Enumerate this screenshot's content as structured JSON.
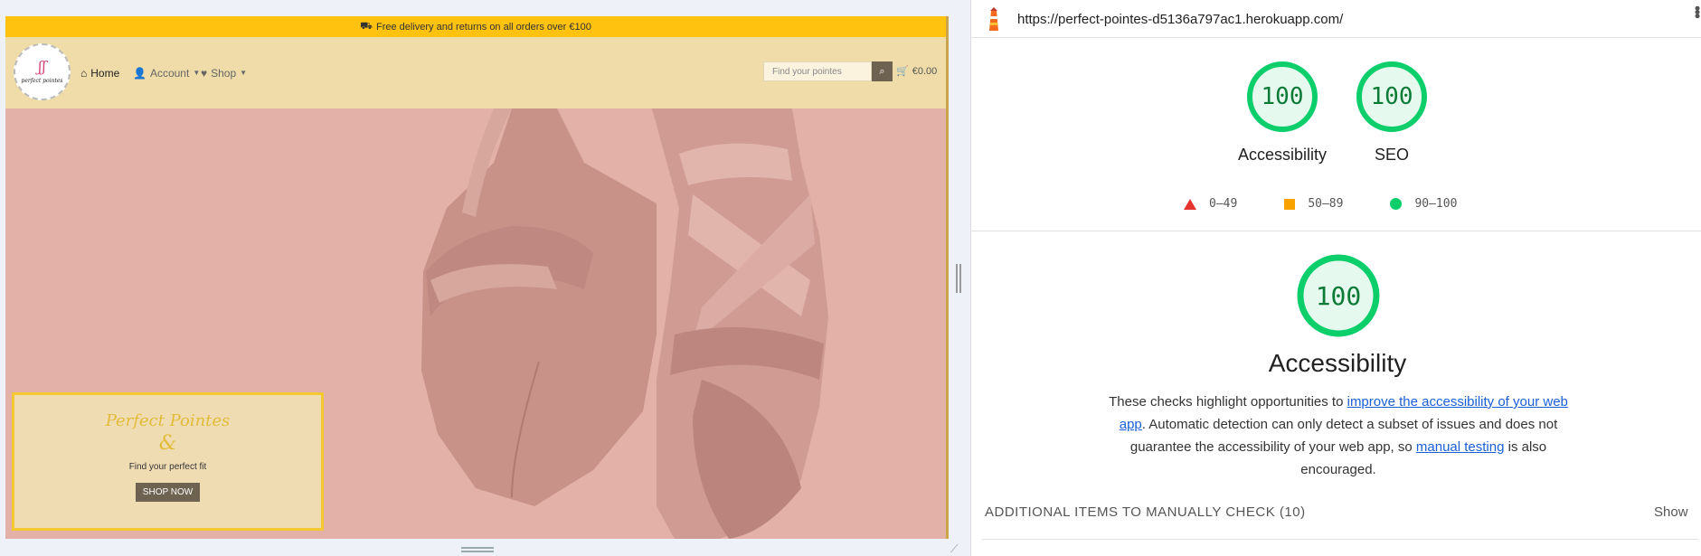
{
  "site": {
    "announcement": "Free delivery and returns on all orders over €100",
    "logo_text": "perfect pointes",
    "nav": {
      "home": "Home",
      "account": "Account",
      "shop": "Shop"
    },
    "search": {
      "placeholder": "Find your pointes"
    },
    "cart_total": "€0.00",
    "promo": {
      "title": "Perfect Pointes",
      "ampersand": "&",
      "subtitle": "Find your perfect fit",
      "cta": "SHOP NOW"
    },
    "colors": {
      "announcement_bg": "#ffc20e",
      "navbar_bg": "#f0dca8",
      "hero_bg": "#e3b1a8",
      "promo_border": "#f4c830",
      "button_bg": "#6e6250"
    }
  },
  "lighthouse": {
    "url": "https://perfect-pointes-d5136a797ac1.herokuapp.com/",
    "scores": [
      {
        "label": "Accessibility",
        "score": 100
      },
      {
        "label": "SEO",
        "score": 100
      }
    ],
    "legend": [
      "0–49",
      "50–89",
      "90–100"
    ],
    "category": {
      "score": 100,
      "title": "Accessibility",
      "desc_1": "These checks highlight opportunities to ",
      "link_1": "improve the accessibility of your web app",
      "desc_2": ". Automatic detection can only detect a subset of issues and does not guarantee the accessibility of your web app, so ",
      "link_2": "manual testing",
      "desc_3": " is also encouraged."
    },
    "manual_checks": {
      "label": "ADDITIONAL ITEMS TO MANUALLY CHECK",
      "count": "(10)",
      "toggle": "Show"
    },
    "colors": {
      "pass": "#0cce6b",
      "average": "#f8a200",
      "fail": "#e3342f"
    }
  }
}
